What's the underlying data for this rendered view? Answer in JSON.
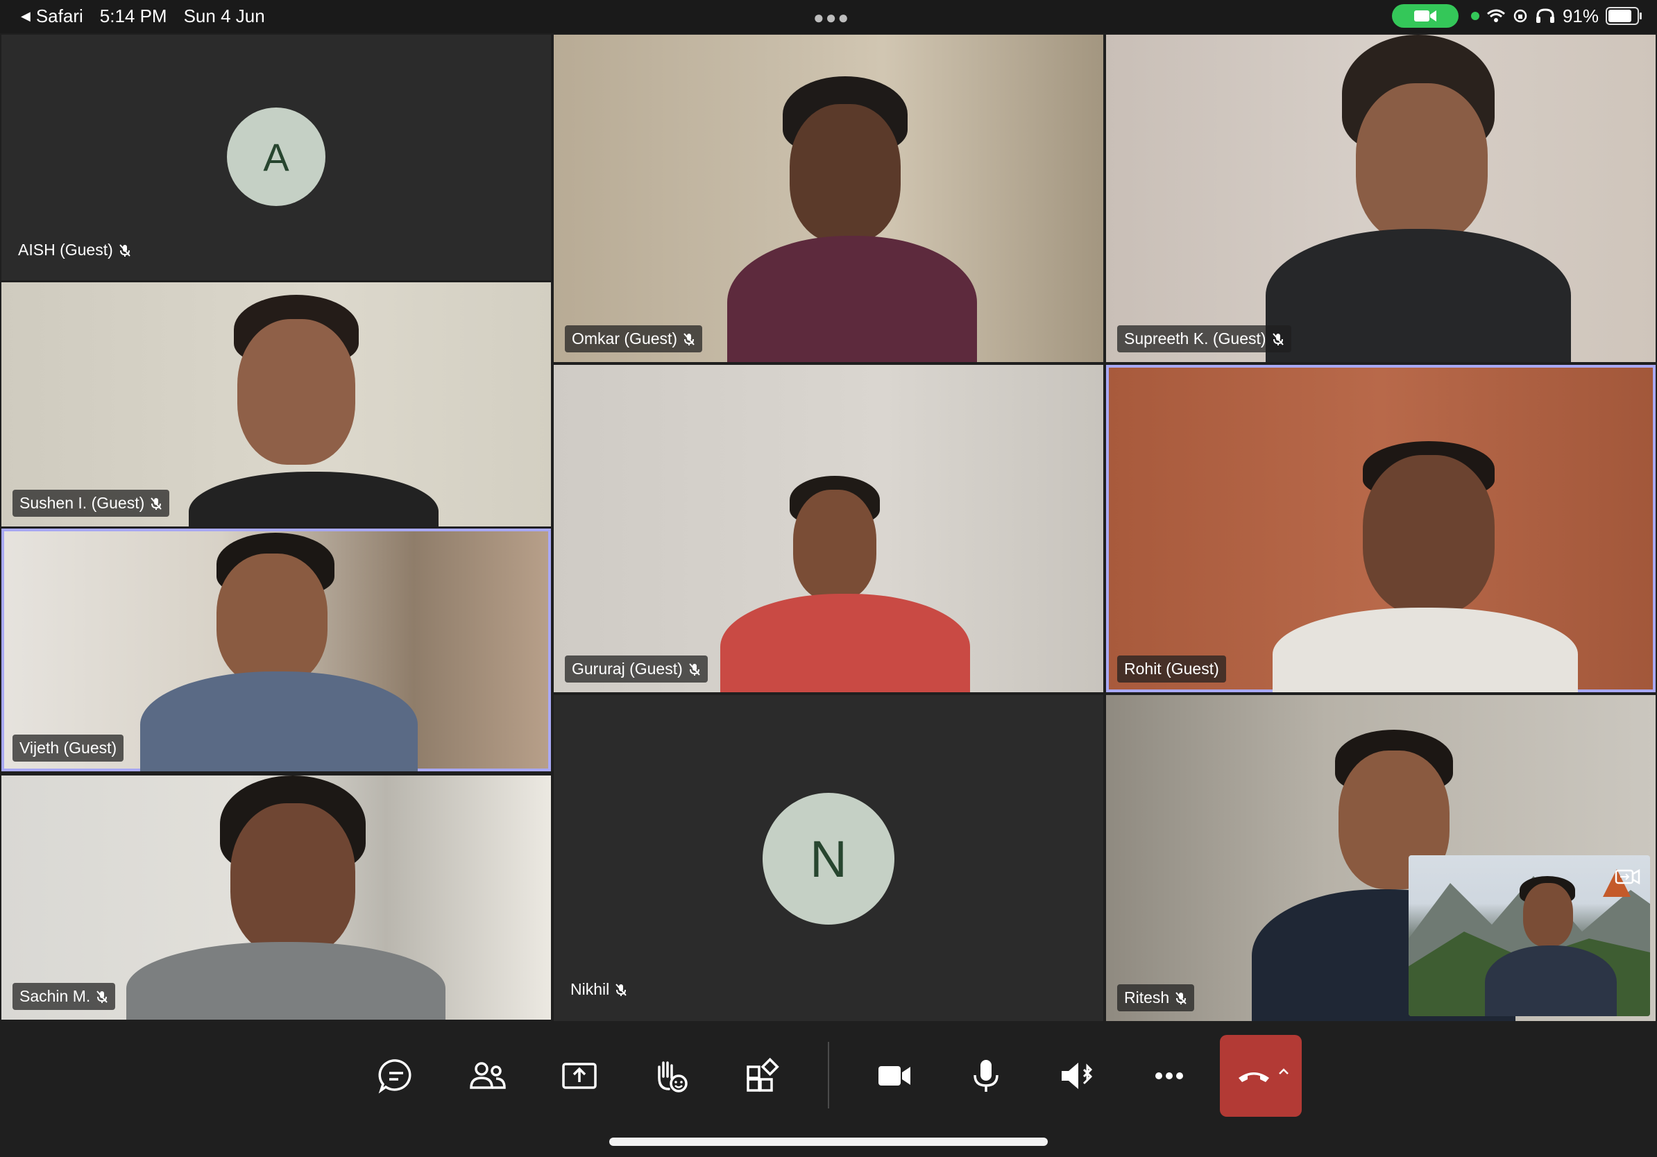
{
  "status_bar": {
    "back_app": "Safari",
    "time": "5:14 PM",
    "date": "Sun 4 Jun",
    "battery_percent": "91%",
    "battery_level": 0.91
  },
  "participants": [
    {
      "name": "AISH (Guest)",
      "avatar_letter": "A",
      "muted": true
    },
    {
      "name": "Omkar (Guest)",
      "muted": true
    },
    {
      "name": "Supreeth K. (Guest)",
      "muted": true
    },
    {
      "name": "Sushen I. (Guest)",
      "muted": true
    },
    {
      "name": "Gururaj (Guest)",
      "muted": true
    },
    {
      "name": "Rohit (Guest)",
      "muted": false,
      "speaking": true
    },
    {
      "name": "Vijeth (Guest)",
      "muted": false,
      "speaking": true
    },
    {
      "name": "Nikhil",
      "avatar_letter": "N",
      "muted": true
    },
    {
      "name": "Sachin M.",
      "muted": true
    },
    {
      "name": "Ritesh",
      "muted": true
    }
  ],
  "toolbar": {
    "items": [
      {
        "icon": "chat-icon"
      },
      {
        "icon": "people-icon"
      },
      {
        "icon": "share-screen-icon"
      },
      {
        "icon": "raise-hand-icon"
      },
      {
        "icon": "apps-icon"
      },
      {
        "icon": "camera-icon"
      },
      {
        "icon": "microphone-icon"
      },
      {
        "icon": "speaker-bluetooth-icon"
      },
      {
        "icon": "more-icon"
      },
      {
        "icon": "hang-up-icon"
      }
    ]
  },
  "colors": {
    "background": "#1f1f1f",
    "tile": "#2d2d2d",
    "active_speaker_border": "#a9a9f5",
    "hang_up": "#b33a35",
    "avatar_bg": "#c5d0c5",
    "status_green": "#34c759"
  }
}
